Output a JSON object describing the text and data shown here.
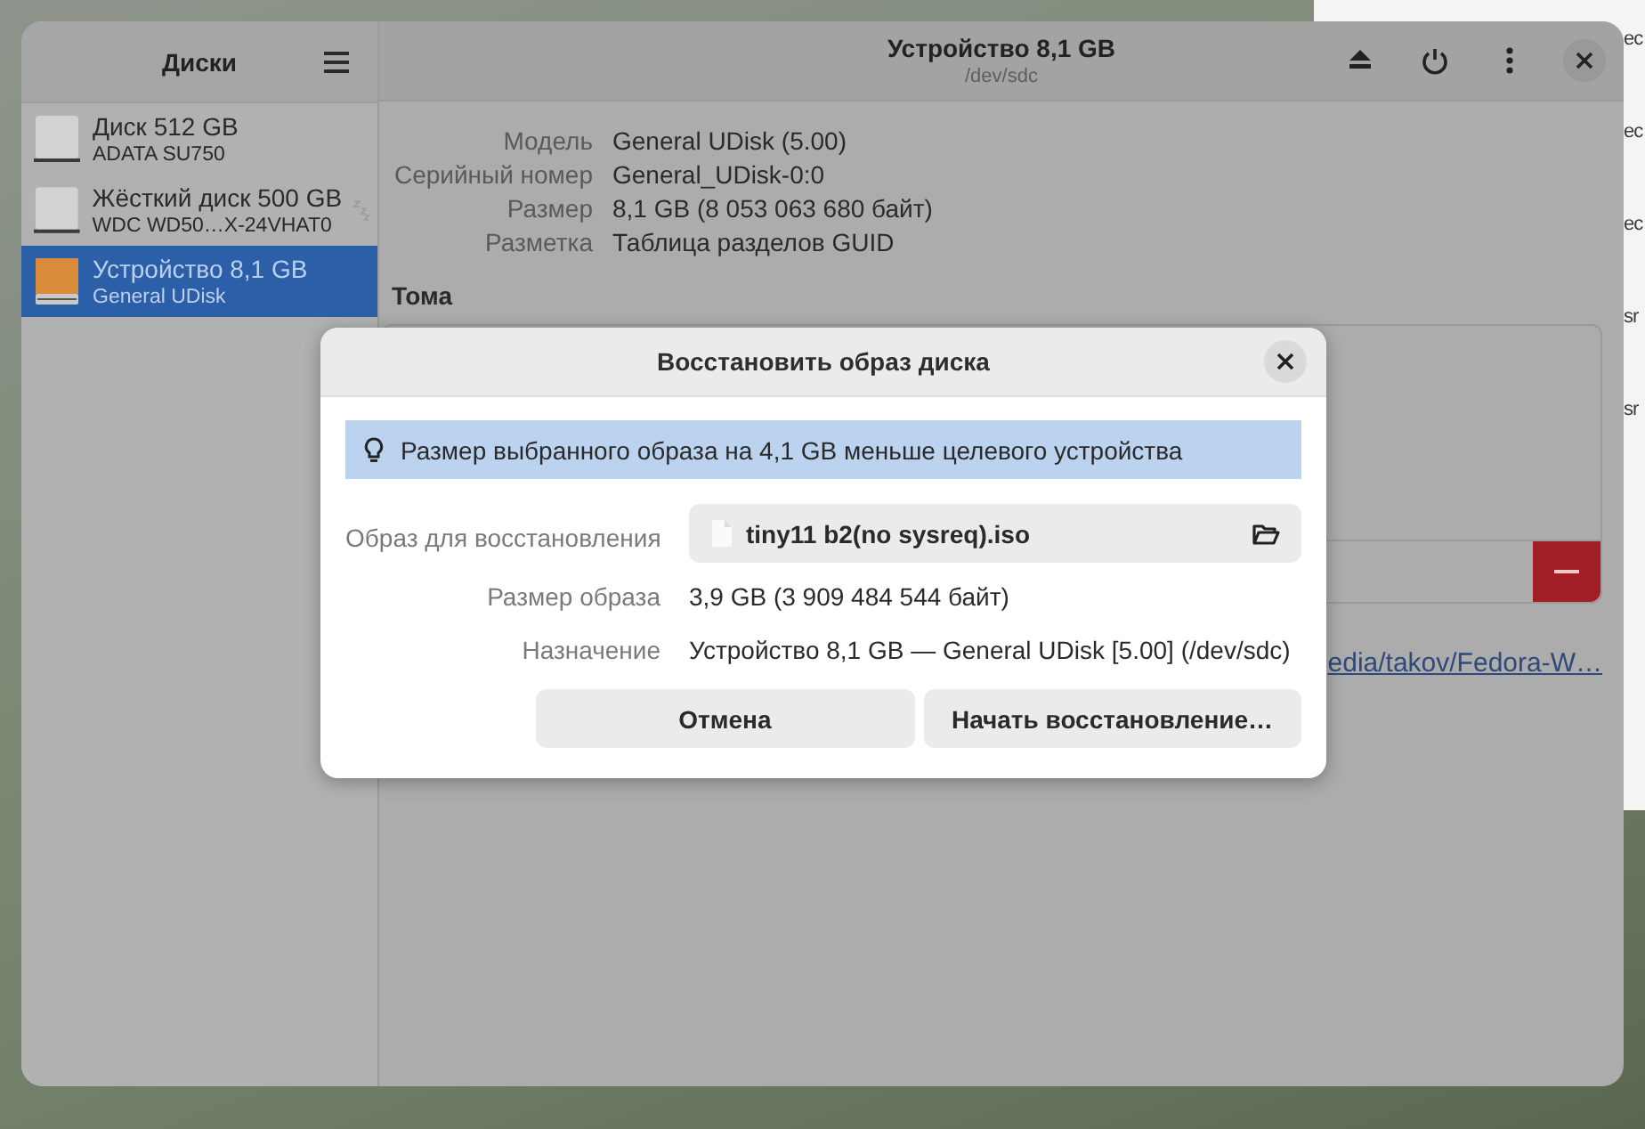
{
  "background_window": {
    "fragments": [
      "ec",
      "ec",
      "ec",
      "sr",
      "sr"
    ]
  },
  "sidebar": {
    "title": "Диски",
    "items": [
      {
        "name": "Диск 512 GB",
        "subtitle": "ADATA SU750",
        "kind": "drive",
        "sleeping": false,
        "selected": false
      },
      {
        "name": "Жёсткий диск 500 GB",
        "subtitle": "WDC WD50…X-24VHAT0",
        "kind": "drive",
        "sleeping": true,
        "selected": false
      },
      {
        "name": "Устройство 8,1 GB",
        "subtitle": "General UDisk",
        "kind": "usb",
        "sleeping": false,
        "selected": true
      }
    ]
  },
  "header": {
    "title": "Устройство 8,1 GB",
    "subtitle": "/dev/sdc"
  },
  "details": [
    {
      "label": "Модель",
      "value": "General UDisk (5.00)"
    },
    {
      "label": "Серийный номер",
      "value": "General_UDisk-0:0"
    },
    {
      "label": "Размер",
      "value": "8,1 GB (8 053 063 680 байт)"
    },
    {
      "label": "Разметка",
      "value": "Таблица разделов GUID"
    }
  ],
  "volumes_heading": "Тома",
  "link_fragment": "edia/takov/Fedora-W…",
  "dialog": {
    "title": "Восстановить образ диска",
    "info": "Размер выбранного образа на 4,1 GB меньше целевого устройства",
    "rows": [
      {
        "label": "Образ для восстановления",
        "value": "tiny11 b2(no sysreq).iso",
        "kind": "file"
      },
      {
        "label": "Размер образа",
        "value": "3,9 GB (3 909 484 544 байт)",
        "kind": "text"
      },
      {
        "label": "Назначение",
        "value": "Устройство 8,1 GB — General UDisk [5.00] (/dev/sdc)",
        "kind": "text"
      }
    ],
    "buttons": [
      "Отмена",
      "Начать восстановление…"
    ]
  }
}
